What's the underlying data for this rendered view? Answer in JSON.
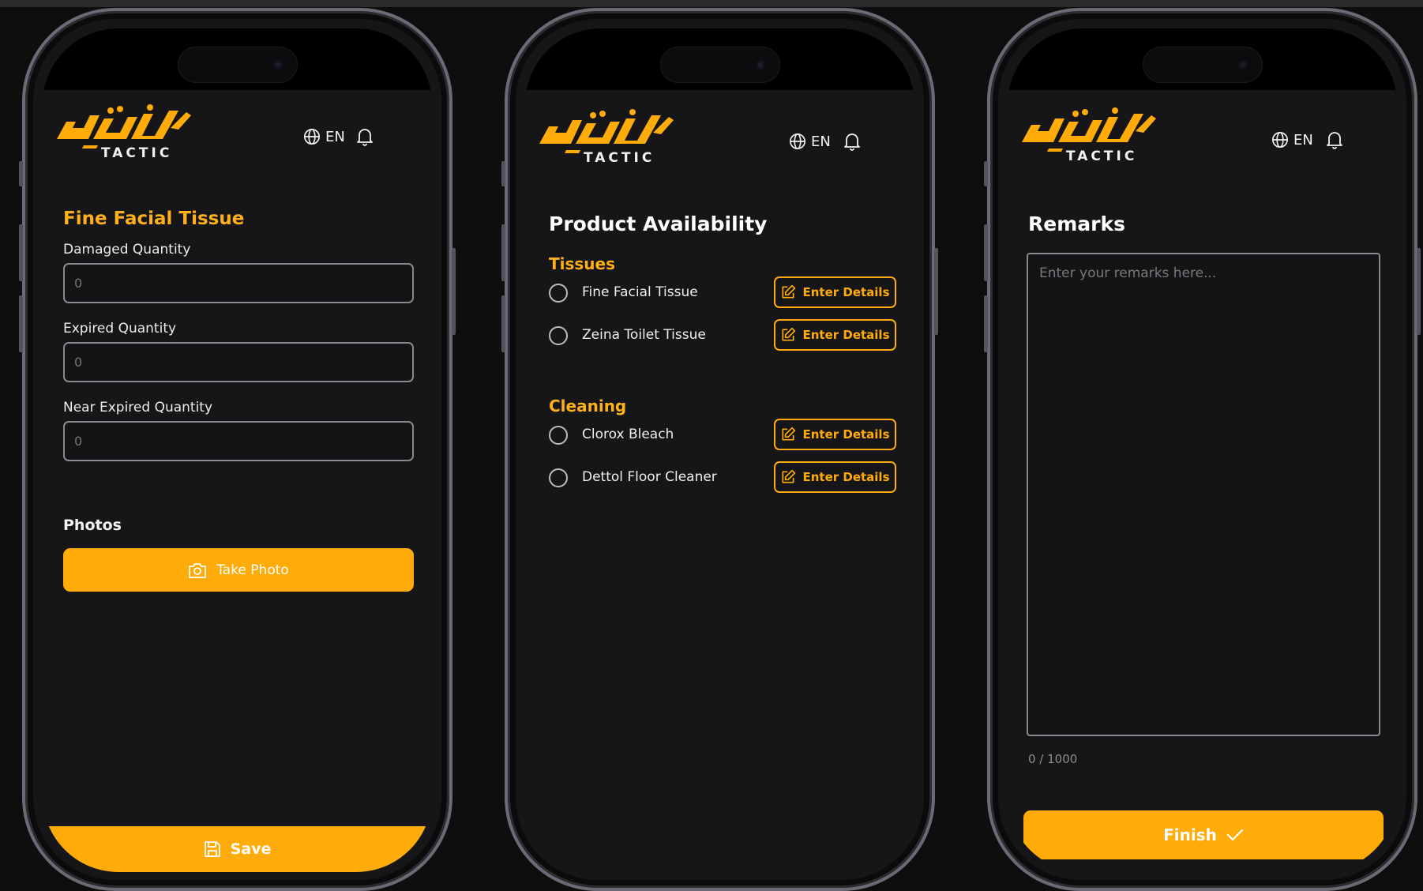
{
  "header": {
    "brand_wordmark": "TACTIC",
    "language": "EN"
  },
  "colors": {
    "accent": "#ffab0a",
    "background": "#161618",
    "input_border": "#8a8a8e"
  },
  "screen1": {
    "title": "Fine Facial Tissue",
    "fields": [
      {
        "label": "Damaged Quantity",
        "placeholder": "0"
      },
      {
        "label": "Expired Quantity",
        "placeholder": "0"
      },
      {
        "label": "Near Expired Quantity",
        "placeholder": "0"
      }
    ],
    "photos_heading": "Photos",
    "take_photo_label": "Take Photo",
    "save_label": "Save"
  },
  "screen2": {
    "title": "Product Availability",
    "categories": [
      {
        "name": "Tissues",
        "products": [
          {
            "name": "Fine Facial Tissue",
            "button": "Enter Details"
          },
          {
            "name": "Zeina Toilet Tissue",
            "button": "Enter Details"
          }
        ]
      },
      {
        "name": "Cleaning",
        "products": [
          {
            "name": "Clorox Bleach",
            "button": "Enter Details"
          },
          {
            "name": "Dettol Floor Cleaner",
            "button": "Enter Details"
          }
        ]
      }
    ]
  },
  "screen3": {
    "title": "Remarks",
    "remarks_placeholder": "Enter your remarks here...",
    "counter": "0 / 1000",
    "finish_label": "Finish"
  }
}
